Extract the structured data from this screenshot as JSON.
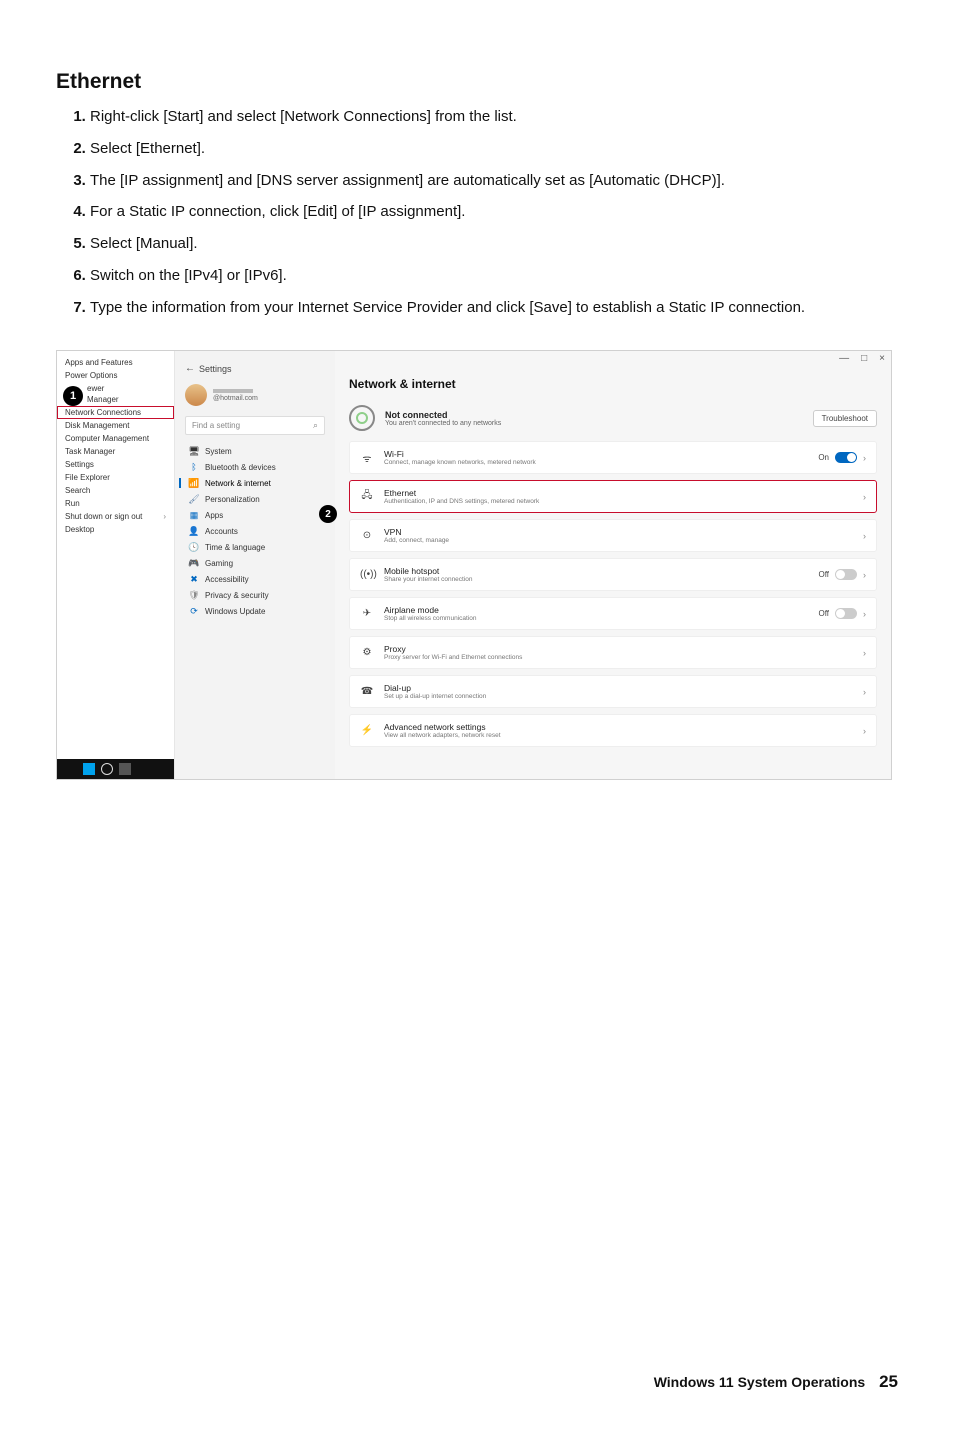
{
  "section_title": "Ethernet",
  "steps": [
    "Right-click [Start] and select [Network Connections] from the list.",
    "Select [Ethernet].",
    "The [IP assignment] and [DNS server assignment] are automatically set as [Automatic (DHCP)].",
    "For a Static IP connection, click [Edit] of [IP assignment].",
    "Select [Manual].",
    "Switch on the [IPv4] or [IPv6].",
    "Type the information from your Internet Service Provider and click [Save] to establish a Static IP connection."
  ],
  "callouts": {
    "one": "1",
    "two": "2"
  },
  "context_menu": {
    "items_top": [
      "Apps and Features",
      "Power Options"
    ],
    "items_split": [
      "ewer",
      "Manager"
    ],
    "highlight": "Network Connections",
    "items_mid": [
      "Disk Management",
      "Computer Management",
      "Task Manager",
      "Settings",
      "File Explorer",
      "Search",
      "Run"
    ],
    "shutdown": "Shut down or sign out",
    "desktop": "Desktop"
  },
  "sidebar": {
    "back_label": "←",
    "app_title": "Settings",
    "account_email": "@hotmail.com",
    "search_placeholder": "Find a setting",
    "items": [
      {
        "icon": "🖥",
        "label": "System"
      },
      {
        "icon": "ᛒ",
        "label": "Bluetooth & devices",
        "color": "#0067c0"
      },
      {
        "icon": "📶",
        "label": "Network & internet",
        "active": true,
        "color": "#0067c0"
      },
      {
        "icon": "🖌",
        "label": "Personalization",
        "color": "#5b7fa6"
      },
      {
        "icon": "▦",
        "label": "Apps",
        "color": "#0067c0"
      },
      {
        "icon": "👤",
        "label": "Accounts",
        "color": "#2e9e53"
      },
      {
        "icon": "🕓",
        "label": "Time & language",
        "color": "#0067c0"
      },
      {
        "icon": "🎮",
        "label": "Gaming",
        "color": "#888"
      },
      {
        "icon": "✖",
        "label": "Accessibility",
        "color": "#0067c0"
      },
      {
        "icon": "🛡",
        "label": "Privacy & security",
        "color": "#888"
      },
      {
        "icon": "⟳",
        "label": "Windows Update",
        "color": "#0067c0"
      }
    ]
  },
  "content": {
    "window_controls": {
      "min": "—",
      "max": "□",
      "close": "×"
    },
    "page_title": "Network & internet",
    "status": {
      "title": "Not connected",
      "sub": "You aren't connected to any networks"
    },
    "troubleshoot_label": "Troubleshoot",
    "rows": [
      {
        "icon": "ᯤ",
        "title": "Wi-Fi",
        "sub": "Connect, manage known networks, metered network",
        "trail": "toggle-on",
        "trail_label": "On"
      },
      {
        "icon": "🖧",
        "title": "Ethernet",
        "sub": "Authentication, IP and DNS settings, metered network",
        "trail": "chev",
        "hl": true
      },
      {
        "icon": "⊙",
        "title": "VPN",
        "sub": "Add, connect, manage",
        "trail": "chev"
      },
      {
        "icon": "((•))",
        "title": "Mobile hotspot",
        "sub": "Share your internet connection",
        "trail": "toggle-off",
        "trail_label": "Off"
      },
      {
        "icon": "✈",
        "title": "Airplane mode",
        "sub": "Stop all wireless communication",
        "trail": "toggle-off",
        "trail_label": "Off"
      },
      {
        "icon": "⚙",
        "title": "Proxy",
        "sub": "Proxy server for Wi-Fi and Ethernet connections",
        "trail": "chev"
      },
      {
        "icon": "☎",
        "title": "Dial-up",
        "sub": "Set up a dial-up internet connection",
        "trail": "chev"
      },
      {
        "icon": "⚡",
        "title": "Advanced network settings",
        "sub": "View all network adapters, network reset",
        "trail": "chev"
      }
    ]
  },
  "footer": {
    "label": "Windows 11 System Operations",
    "page": "25"
  }
}
